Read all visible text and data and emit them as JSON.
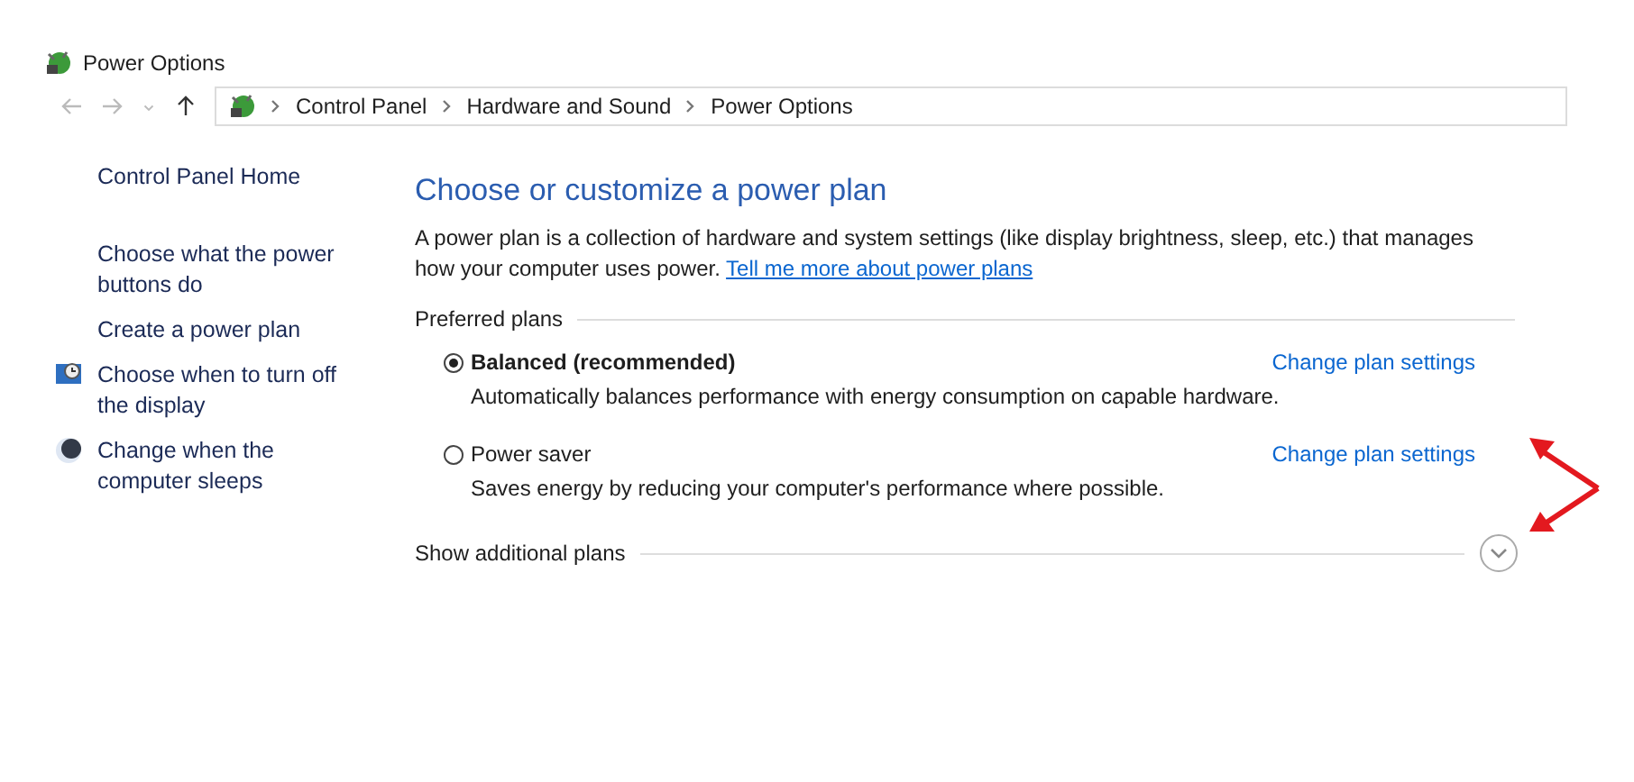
{
  "window": {
    "title": "Power Options"
  },
  "address_bar": {
    "crumbs": [
      "Control Panel",
      "Hardware and Sound",
      "Power Options"
    ]
  },
  "sidebar": {
    "items": [
      {
        "label": "Control Panel Home",
        "kind": "plain"
      },
      {
        "label": "Choose what the power buttons do",
        "kind": "plain"
      },
      {
        "label": "Create a power plan",
        "kind": "plain"
      },
      {
        "label": "Choose when to turn off the display",
        "kind": "monitor"
      },
      {
        "label": "Change when the computer sleeps",
        "kind": "moon"
      }
    ]
  },
  "main": {
    "heading": "Choose or customize a power plan",
    "intro": "A power plan is a collection of hardware and system settings (like display brightness, sleep, etc.) that manages how your computer uses power.",
    "intro_link": "Tell me more about power plans",
    "group_label": "Preferred plans",
    "plans": [
      {
        "name": "Balanced (recommended)",
        "selected": true,
        "description": "Automatically balances performance with energy consumption on capable hardware.",
        "link": "Change plan settings"
      },
      {
        "name": "Power saver",
        "selected": false,
        "description": "Saves energy by reducing your computer's performance where possible.",
        "link": "Change plan settings"
      }
    ],
    "more": {
      "label": "Show additional plans",
      "expanded": false
    }
  }
}
